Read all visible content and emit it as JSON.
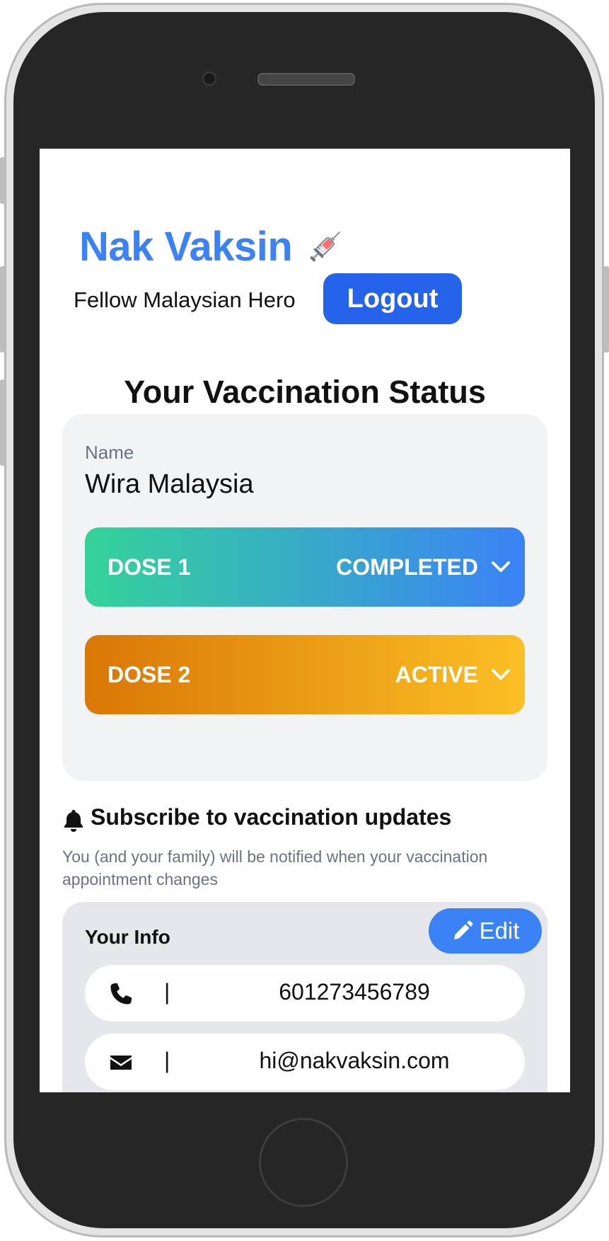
{
  "app": {
    "title": "Nak Vaksin",
    "subtitle": "Fellow Malaysian Hero",
    "logout_label": "Logout"
  },
  "status": {
    "heading": "Your Vaccination Status",
    "name_label": "Name",
    "name_value": "Wira Malaysia",
    "doses": [
      {
        "label": "DOSE 1",
        "status": "COMPLETED",
        "colors": [
          "#34d399",
          "#3b82f6"
        ]
      },
      {
        "label": "DOSE 2",
        "status": "ACTIVE",
        "colors": [
          "#d97706",
          "#fbbf24"
        ]
      }
    ]
  },
  "subscribe": {
    "heading": "Subscribe to vaccination updates",
    "description": "You (and your family) will be notified when your vaccination appointment changes",
    "info_title": "Your Info",
    "edit_label": "Edit",
    "contacts": [
      {
        "icon": "phone-icon",
        "separator": "|",
        "value": "601273456789"
      },
      {
        "icon": "envelope-icon",
        "separator": "|",
        "value": "hi@nakvaksin.com"
      }
    ]
  },
  "colors": {
    "brand": "#3b82f6",
    "logout": "#2563eb"
  }
}
